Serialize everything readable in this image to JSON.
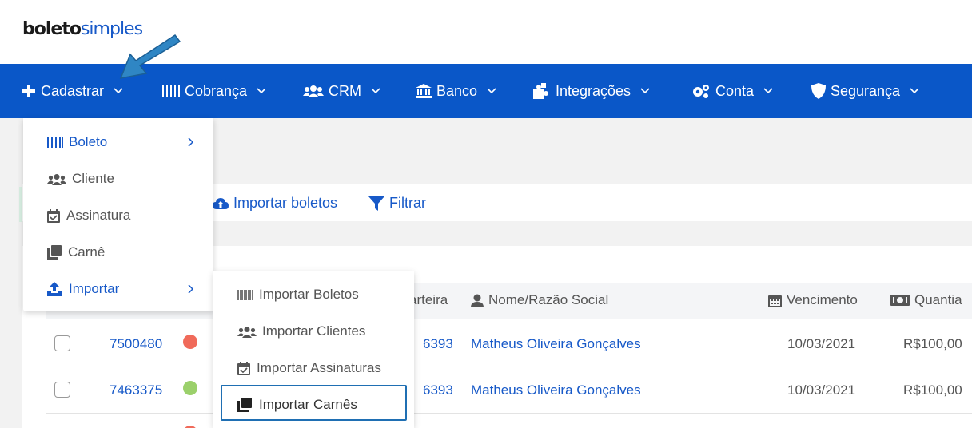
{
  "logo": {
    "part1": "boleto",
    "part2": "simples"
  },
  "nav": {
    "items": [
      {
        "label": "Cadastrar",
        "icon": "plus-icon"
      },
      {
        "label": "Cobrança",
        "icon": "barcode-icon"
      },
      {
        "label": "CRM",
        "icon": "users-icon"
      },
      {
        "label": "Banco",
        "icon": "bank-icon"
      },
      {
        "label": "Integrações",
        "icon": "puzzle-icon"
      },
      {
        "label": "Conta",
        "icon": "gears-icon"
      },
      {
        "label": "Segurança",
        "icon": "shield-icon"
      }
    ]
  },
  "cadastrar_menu": {
    "items": [
      {
        "label": "Boleto",
        "icon": "barcode-icon",
        "has_submenu": true
      },
      {
        "label": "Cliente",
        "icon": "users-icon",
        "has_submenu": false
      },
      {
        "label": "Assinatura",
        "icon": "calendar-check-icon",
        "has_submenu": false
      },
      {
        "label": "Carnê",
        "icon": "copy-icon",
        "has_submenu": false
      },
      {
        "label": "Importar",
        "icon": "upload-icon",
        "has_submenu": true
      }
    ]
  },
  "importar_menu": {
    "items": [
      {
        "label": "Importar Boletos",
        "icon": "barcode-icon"
      },
      {
        "label": "Importar Clientes",
        "icon": "users-icon"
      },
      {
        "label": "Importar Assinaturas",
        "icon": "calendar-check-icon"
      },
      {
        "label": "Importar Carnês",
        "icon": "copy-icon",
        "highlighted": true
      }
    ]
  },
  "toolbar": {
    "import_label": "Importar boletos",
    "filter_label": "Filtrar"
  },
  "table": {
    "headers": {
      "carteira": "arteira",
      "nome": "Nome/Razão Social",
      "vencimento": "Vencimento",
      "quantia": "Quantia"
    },
    "rows": [
      {
        "id": "7500480",
        "status_color": "#f06a5a",
        "carteira": "6393",
        "nome": "Matheus Oliveira Gonçalves",
        "vencimento": "10/03/2021",
        "quantia": "R$100,00"
      },
      {
        "id": "7463375",
        "status_color": "#9bd06b",
        "carteira": "6393",
        "nome": "Matheus Oliveira Gonçalves",
        "vencimento": "10/03/2021",
        "quantia": "R$100,00"
      }
    ]
  },
  "colors": {
    "nav_bg": "#0a57c8",
    "link": "#1759c8",
    "highlight_border": "#1f6fb3",
    "arrow": "#2f86c4"
  }
}
